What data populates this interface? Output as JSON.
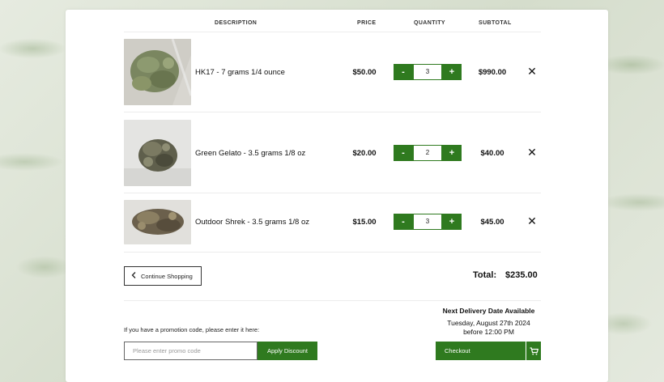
{
  "table": {
    "headers": [
      "DESCRIPTION",
      "PRICE",
      "QUANTITY",
      "SUBTOTAL"
    ]
  },
  "cart": {
    "items": [
      {
        "name": "HK17 - 7 grams 1/4 ounce",
        "price": "$50.00",
        "quantity": "3",
        "subtotal": "$990.00",
        "image_icon": "cannabis-bud-in-bag"
      },
      {
        "name": "Green Gelato - 3.5 grams 1/8 oz",
        "price": "$20.00",
        "quantity": "2",
        "subtotal": "$40.00",
        "image_icon": "cannabis-bud"
      },
      {
        "name": "Outdoor Shrek - 3.5 grams 1/8 oz",
        "price": "$15.00",
        "quantity": "3",
        "subtotal": "$45.00",
        "image_icon": "cannabis-bud"
      }
    ],
    "minus_label": "-",
    "plus_label": "+",
    "remove_label": "✕"
  },
  "actions": {
    "continue_label": "Continue Shopping"
  },
  "summary": {
    "total_label": "Total:",
    "total_value": "$235.00"
  },
  "promo": {
    "prompt": "If you have a promotion code, please enter it here:",
    "placeholder": "Please enter promo code",
    "apply_label": "Apply Discount"
  },
  "delivery": {
    "title": "Next Delivery Date Available",
    "date": "Tuesday, August 27th 2024",
    "time": "before 12:00 PM"
  },
  "checkout": {
    "label": "Checkout"
  },
  "colors": {
    "accent": "#2f7a1f",
    "panel": "#ffffff",
    "background": "#dfe5d9"
  }
}
